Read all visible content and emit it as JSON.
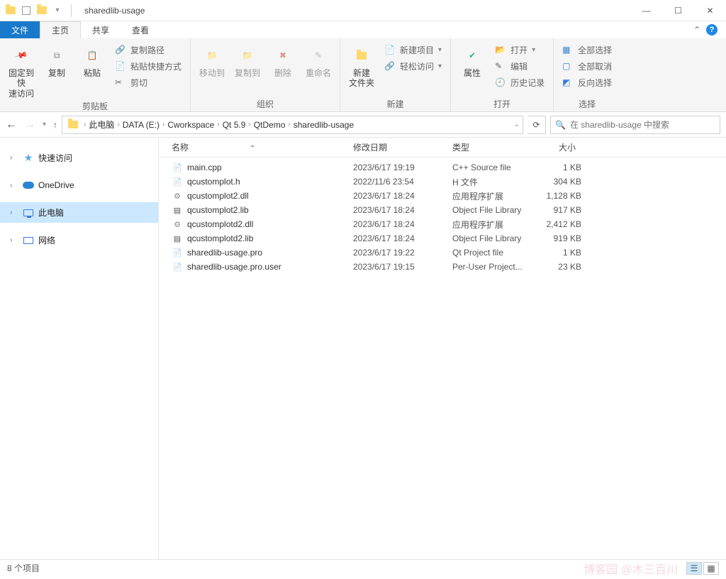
{
  "window": {
    "title": "sharedlib-usage"
  },
  "tabs": {
    "file": "文件",
    "home": "主页",
    "share": "共享",
    "view": "查看"
  },
  "ribbon": {
    "clipboard": {
      "pin": "固定到快\n速访问",
      "copy": "复制",
      "paste": "粘贴",
      "copypath": "复制路径",
      "pasteshortcut": "粘贴快捷方式",
      "cut": "剪切",
      "label": "剪贴板"
    },
    "organize": {
      "moveto": "移动到",
      "copyto": "复制到",
      "delete": "删除",
      "rename": "重命名",
      "label": "组织"
    },
    "new": {
      "newfolder": "新建\n文件夹",
      "newitem": "新建项目",
      "easyaccess": "轻松访问",
      "label": "新建"
    },
    "open": {
      "properties": "属性",
      "open": "打开",
      "edit": "编辑",
      "history": "历史记录",
      "label": "打开"
    },
    "select": {
      "selectall": "全部选择",
      "deselectall": "全部取消",
      "invert": "反向选择",
      "label": "选择"
    }
  },
  "breadcrumb": [
    "此电脑",
    "DATA (E:)",
    "Cworkspace",
    "Qt 5.9",
    "QtDemo",
    "sharedlib-usage"
  ],
  "search": {
    "placeholder": "在 sharedlib-usage 中搜索"
  },
  "sidebar": {
    "quick": "快速访问",
    "onedrive": "OneDrive",
    "thispc": "此电脑",
    "network": "网络"
  },
  "columns": {
    "name": "名称",
    "date": "修改日期",
    "type": "类型",
    "size": "大小"
  },
  "files": [
    {
      "icon": "cpp",
      "name": "main.cpp",
      "date": "2023/6/17 19:19",
      "type": "C++ Source file",
      "size": "1 KB"
    },
    {
      "icon": "h",
      "name": "qcustomplot.h",
      "date": "2022/11/6 23:54",
      "type": "H 文件",
      "size": "304 KB"
    },
    {
      "icon": "dll",
      "name": "qcustomplot2.dll",
      "date": "2023/6/17 18:24",
      "type": "应用程序扩展",
      "size": "1,128 KB"
    },
    {
      "icon": "lib",
      "name": "qcustomplot2.lib",
      "date": "2023/6/17 18:24",
      "type": "Object File Library",
      "size": "917 KB"
    },
    {
      "icon": "dll",
      "name": "qcustomplotd2.dll",
      "date": "2023/6/17 18:24",
      "type": "应用程序扩展",
      "size": "2,412 KB"
    },
    {
      "icon": "lib",
      "name": "qcustomplotd2.lib",
      "date": "2023/6/17 18:24",
      "type": "Object File Library",
      "size": "919 KB"
    },
    {
      "icon": "pro",
      "name": "sharedlib-usage.pro",
      "date": "2023/6/17 19:22",
      "type": "Qt Project file",
      "size": "1 KB"
    },
    {
      "icon": "usr",
      "name": "sharedlib-usage.pro.user",
      "date": "2023/6/17 19:15",
      "type": "Per-User Project...",
      "size": "23 KB"
    }
  ],
  "status": {
    "count": "8 个项目",
    "watermark": "博客园 @木三百川"
  }
}
